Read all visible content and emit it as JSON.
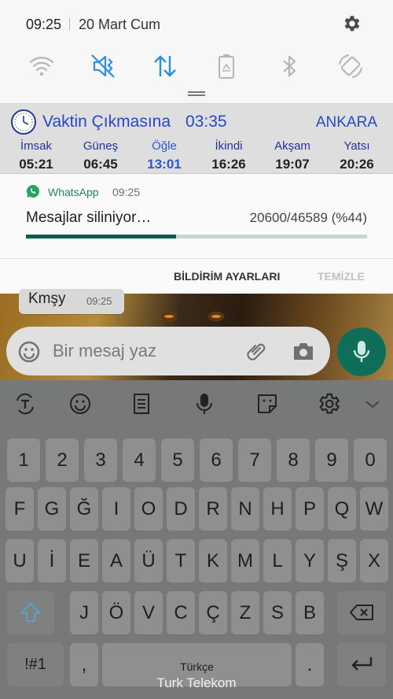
{
  "status": {
    "time": "09:25",
    "date": "20 Mart Cum"
  },
  "quick_settings": [
    "wifi-icon",
    "sound-off-icon",
    "mobile-data-icon",
    "battery-saver-icon",
    "bluetooth-icon",
    "auto-rotate-icon"
  ],
  "colors": {
    "accent_blue": "#2d8fe0",
    "shade_bg": "#f7f7f7",
    "whatsapp_green": "#0c5e4c"
  },
  "prayer": {
    "title": "Vaktin Çıkmasına",
    "remaining": "03:35",
    "city": "ANKARA",
    "times": [
      {
        "name": "İmsak",
        "time": "05:21"
      },
      {
        "name": "Güneş",
        "time": "06:45"
      },
      {
        "name": "Öğle",
        "time": "13:01"
      },
      {
        "name": "İkindi",
        "time": "16:26"
      },
      {
        "name": "Akşam",
        "time": "19:07"
      },
      {
        "name": "Yatsı",
        "time": "20:26"
      }
    ],
    "active_index": 2
  },
  "whatsapp": {
    "app": "WhatsApp",
    "time": "09:25",
    "text": "Mesajlar siliniyor…",
    "count": "20600/46589 (%44)",
    "progress": 0.44
  },
  "actions": {
    "settings": "BİLDİRİM AYARLARI",
    "clear": "TEMİZLE"
  },
  "chat": {
    "bubble_text": "Kmşy",
    "bubble_time": "09:25",
    "input_placeholder": "Bir mesaj yaz"
  },
  "keyboard": {
    "rows": [
      [
        "1",
        "2",
        "3",
        "4",
        "5",
        "6",
        "7",
        "8",
        "9",
        "0"
      ],
      [
        "F",
        "G",
        "Ğ",
        "I",
        "O",
        "D",
        "R",
        "N",
        "H",
        "P",
        "Q",
        "W"
      ],
      [
        "U",
        "İ",
        "E",
        "A",
        "Ü",
        "T",
        "K",
        "M",
        "L",
        "Y",
        "Ş",
        "X"
      ],
      [
        "J",
        "Ö",
        "V",
        "C",
        "Ç",
        "Z",
        "S",
        "B"
      ]
    ],
    "sym_label": "!#1",
    "comma": ",",
    "space_label": "Türkçe",
    "period": "."
  },
  "carrier": "Turk Telekom"
}
